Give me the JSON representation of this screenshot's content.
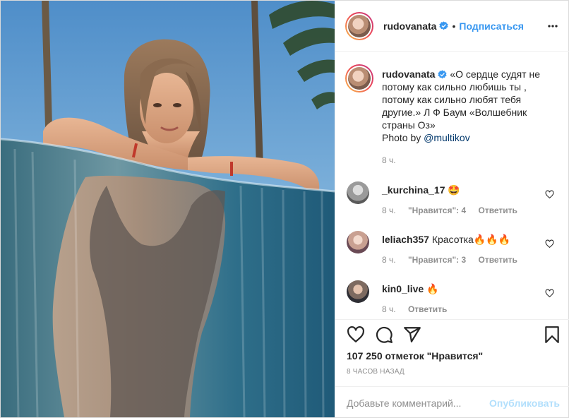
{
  "photo": {
    "alt": ""
  },
  "header": {
    "username": "rudovanata",
    "dot": "•",
    "follow_label": "Подписаться"
  },
  "caption": {
    "username": "rudovanata",
    "text": "«О сердце судят не потому как сильно любишь ты , потому как сильно любят тебя другие.» Л Ф Баум «Волшебник страны Оз»",
    "photo_by_prefix": "Photo by ",
    "photo_by_mention": "@multikov",
    "time": "8 ч."
  },
  "comments": [
    {
      "username": "_kurchina_17",
      "text": "🤩",
      "time": "8 ч.",
      "likes": "\"Нравится\": 4",
      "reply": "Ответить"
    },
    {
      "username": "leliach357",
      "text": "Красотка🔥🔥🔥",
      "time": "8 ч.",
      "likes": "\"Нравится\": 3",
      "reply": "Ответить"
    },
    {
      "username": "kin0_live",
      "text": "🔥",
      "time": "8 ч.",
      "likes": "",
      "reply": "Ответить"
    }
  ],
  "actions": {
    "icons": [
      "heart-icon",
      "comment-icon",
      "share-icon",
      "bookmark-icon"
    ],
    "likes_text": "107 250 отметок \"Нравится\"",
    "post_time": "8 ЧАСОВ НАЗАД"
  },
  "composer": {
    "placeholder": "Добавьте комментарий...",
    "publish_label": "Опубликовать"
  },
  "colors": {
    "accent": "#3897f0",
    "publish_disabled": "#b2dffc",
    "muted": "#8e8e8e"
  }
}
